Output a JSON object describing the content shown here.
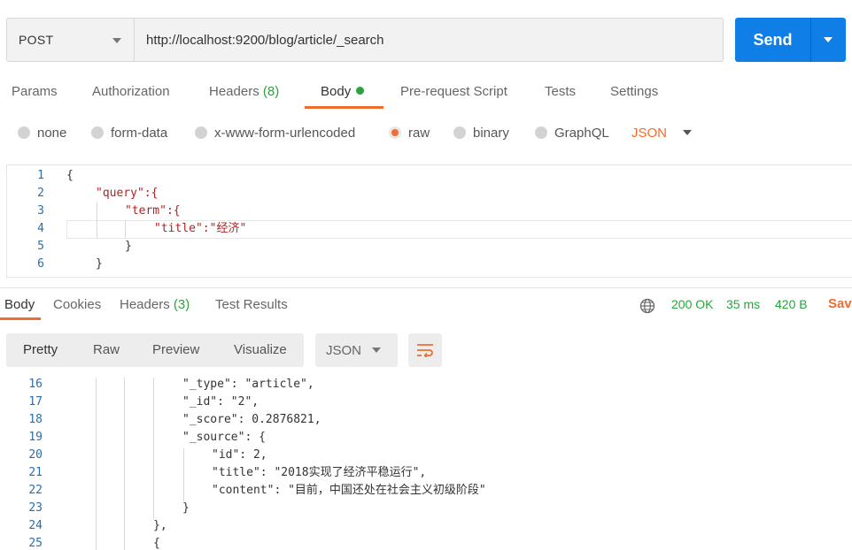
{
  "request": {
    "method": "POST",
    "url": "http://localhost:9200/blog/article/_search",
    "send_label": "Send"
  },
  "request_tabs": [
    {
      "label": "Params"
    },
    {
      "label": "Authorization"
    },
    {
      "label": "Headers",
      "count": "(8)"
    },
    {
      "label": "Body",
      "active": true
    },
    {
      "label": "Pre-request Script"
    },
    {
      "label": "Tests"
    },
    {
      "label": "Settings"
    }
  ],
  "body_types": [
    {
      "label": "none",
      "selected": false
    },
    {
      "label": "form-data",
      "selected": false
    },
    {
      "label": "x-www-form-urlencoded",
      "selected": false
    },
    {
      "label": "raw",
      "selected": true
    },
    {
      "label": "binary",
      "selected": false
    },
    {
      "label": "GraphQL",
      "selected": false
    }
  ],
  "body_format": "JSON",
  "request_body": {
    "line_numbers": [
      "1",
      "2",
      "3",
      "4",
      "5",
      "6"
    ],
    "lines": [
      "{",
      "\"query\":{",
      "\"term\":{",
      "\"title\":\"经济\"",
      "}",
      "}"
    ]
  },
  "response_tabs": [
    {
      "label": "Body",
      "active": true
    },
    {
      "label": "Cookies"
    },
    {
      "label": "Headers",
      "count": "(3)"
    },
    {
      "label": "Test Results"
    }
  ],
  "response_status": {
    "status": "200 OK",
    "time": "35 ms",
    "size": "420 B",
    "save_label": "Save"
  },
  "view_modes": [
    "Pretty",
    "Raw",
    "Preview",
    "Visualize"
  ],
  "response_format": "JSON",
  "response_body": {
    "line_numbers": [
      "16",
      "17",
      "18",
      "19",
      "20",
      "21",
      "22",
      "23",
      "24",
      "25"
    ],
    "lines": [
      "\"_type\": \"article\",",
      "\"_id\": \"2\",",
      "\"_score\": 0.2876821,",
      "\"_source\": {",
      "\"id\": 2,",
      "\"title\": \"2018实现了经济平稳运行\",",
      "\"content\": \"目前，中国还处在社会主义初级阶段\"",
      "}",
      "},",
      "{"
    ]
  },
  "colors": {
    "accent": "#f06d2d",
    "send": "#0f7ee6",
    "success": "#2aa33d"
  }
}
